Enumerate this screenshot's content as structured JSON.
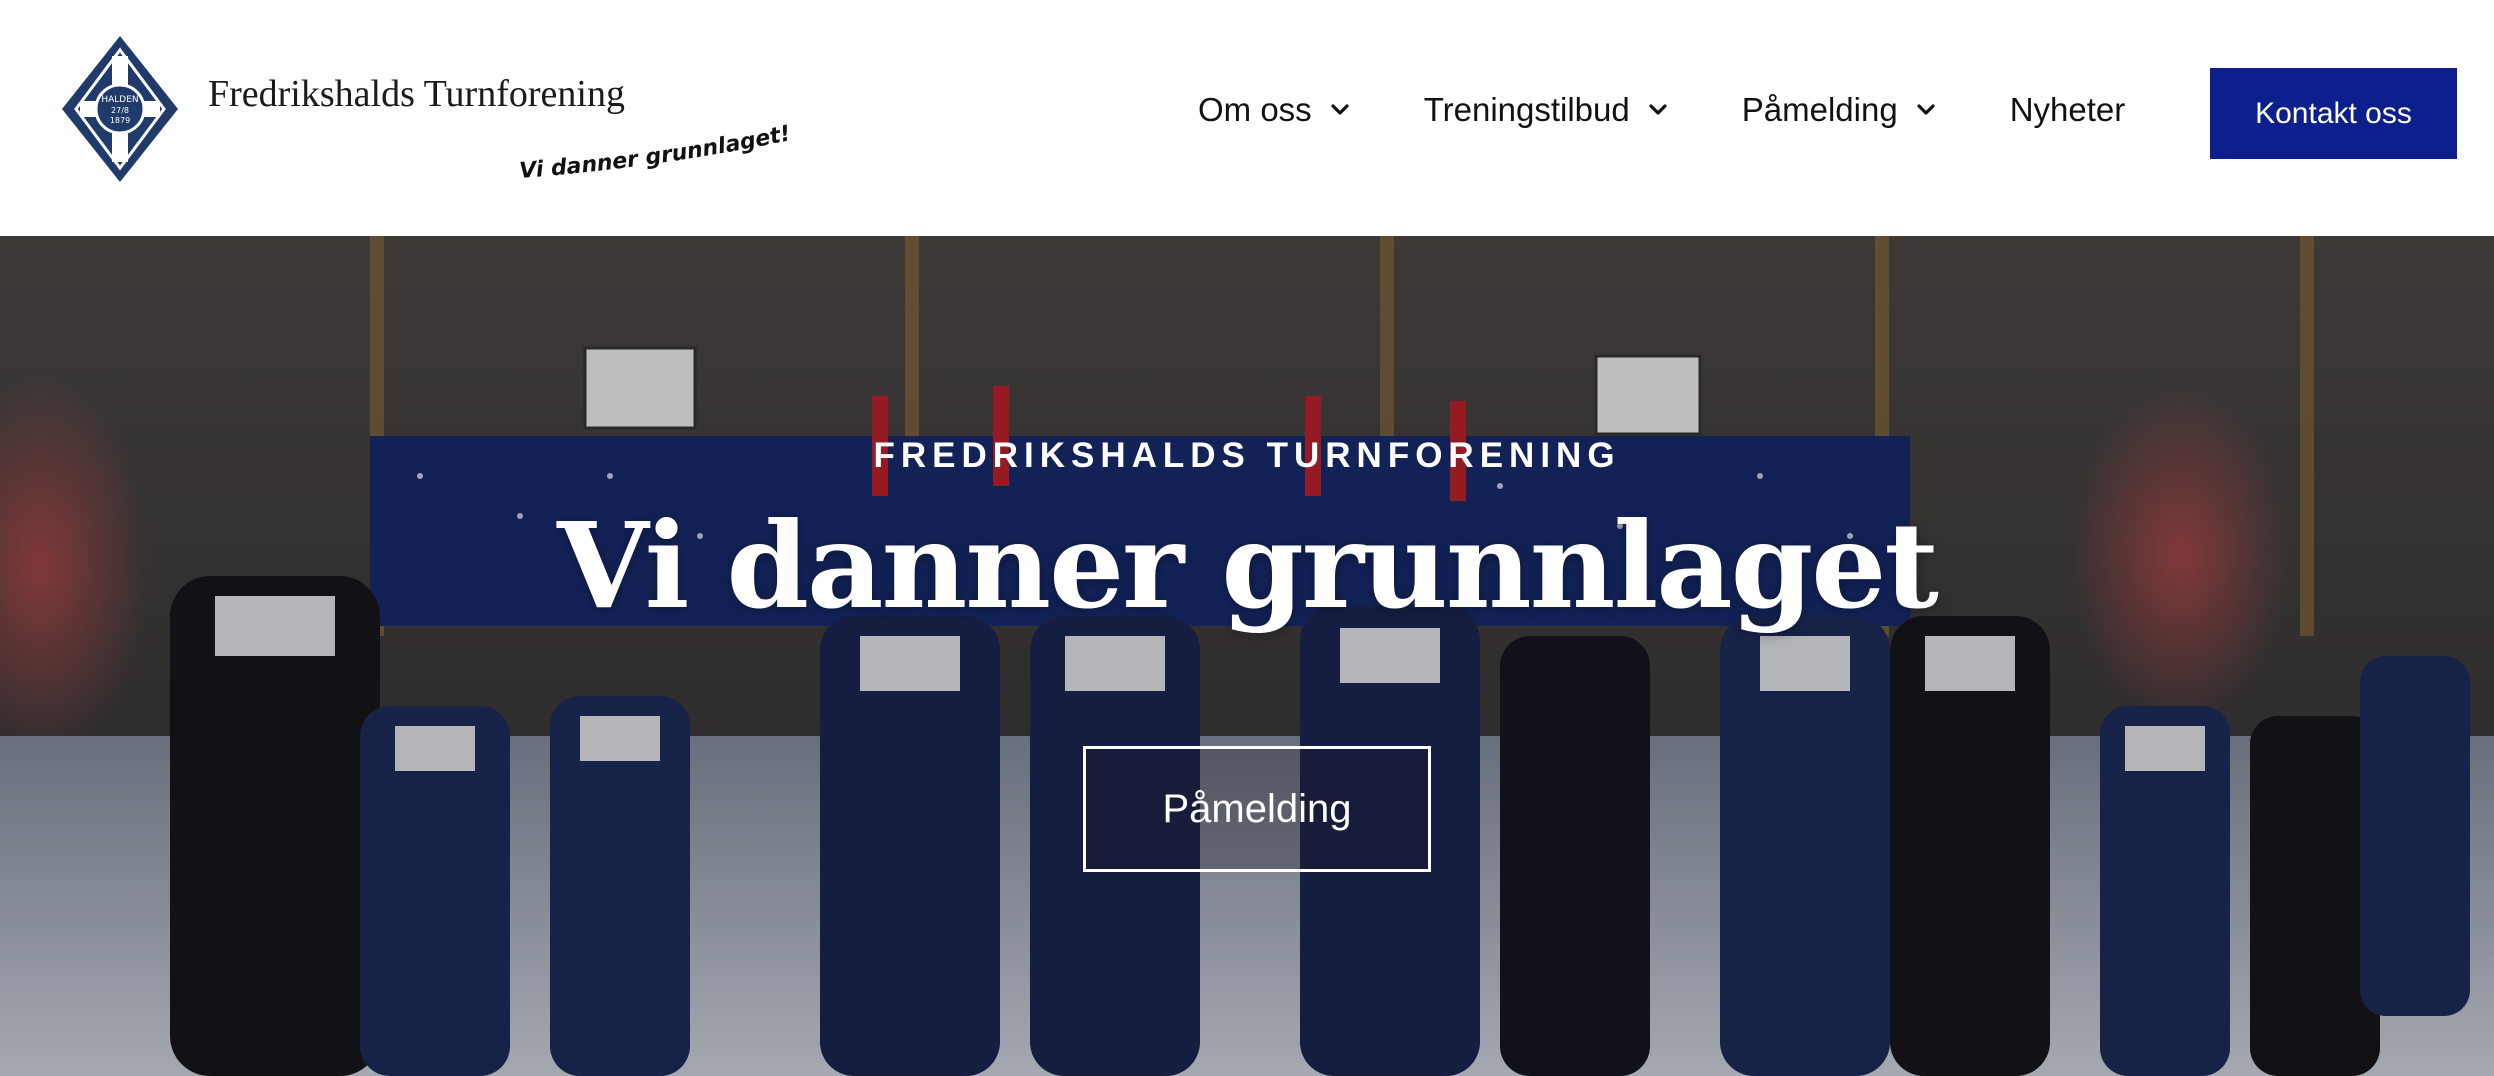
{
  "header": {
    "logo": {
      "name": "Fredrikshalds Turnforening",
      "tagline": "Vi danner grunnlaget!",
      "emblem_text": [
        "HALDEN",
        "27/8",
        "1879"
      ]
    },
    "nav": [
      {
        "label": "Om oss",
        "has_dropdown": true
      },
      {
        "label": "Treningstilbud",
        "has_dropdown": true
      },
      {
        "label": "Påmelding",
        "has_dropdown": true
      },
      {
        "label": "Nyheter",
        "has_dropdown": false
      }
    ],
    "cta_label": "Kontakt oss"
  },
  "hero": {
    "kicker": "FREDRIKSHALDS TURNFORENING",
    "title": "Vi danner grunnlaget",
    "button_label": "Påmelding"
  },
  "colors": {
    "brand_navy": "#0d1f8c",
    "logo_navy": "#1f3a6b",
    "text_dark": "#111111",
    "white": "#ffffff"
  },
  "icons": {
    "nav_dropdown": "chevron-down-icon",
    "logo": "gymnastics-club-emblem"
  }
}
